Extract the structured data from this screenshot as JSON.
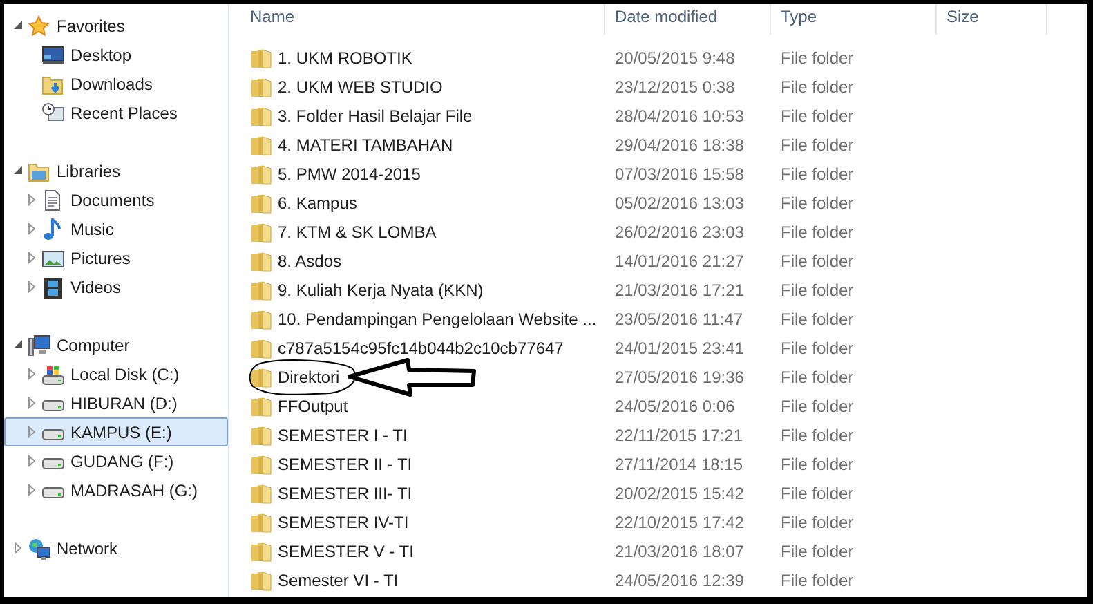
{
  "sidebar": {
    "groups": [
      {
        "label": "Favorites",
        "kind": "favorites",
        "expanded": true,
        "children": [
          {
            "label": "Desktop",
            "kind": "desktop"
          },
          {
            "label": "Downloads",
            "kind": "downloads"
          },
          {
            "label": "Recent Places",
            "kind": "recent"
          }
        ]
      },
      {
        "label": "Libraries",
        "kind": "libraries",
        "expanded": true,
        "children": [
          {
            "label": "Documents",
            "kind": "documents",
            "expanded": false,
            "selected": false
          },
          {
            "label": "Music",
            "kind": "music",
            "expanded": false,
            "selected": false
          },
          {
            "label": "Pictures",
            "kind": "pictures",
            "expanded": false,
            "selected": false
          },
          {
            "label": "Videos",
            "kind": "videos",
            "expanded": false,
            "selected": false
          }
        ]
      },
      {
        "label": "Computer",
        "kind": "computer",
        "expanded": true,
        "children": [
          {
            "label": "Local Disk (C:)",
            "kind": "system-drive",
            "expanded": false,
            "selected": false
          },
          {
            "label": "HIBURAN (D:)",
            "kind": "drive",
            "expanded": false,
            "selected": false
          },
          {
            "label": "KAMPUS (E:)",
            "kind": "drive",
            "expanded": false,
            "selected": true
          },
          {
            "label": "GUDANG (F:)",
            "kind": "drive",
            "expanded": false,
            "selected": false
          },
          {
            "label": "MADRASAH (G:)",
            "kind": "drive",
            "expanded": false,
            "selected": false
          }
        ]
      },
      {
        "label": "Network",
        "kind": "network",
        "expanded": false
      }
    ]
  },
  "table": {
    "columns": [
      "Name",
      "Date modified",
      "Type",
      "Size"
    ],
    "rows": [
      {
        "name": "1. UKM ROBOTIK",
        "date": "20/05/2015 9:48",
        "type": "File folder"
      },
      {
        "name": "2. UKM WEB STUDIO",
        "date": "23/12/2015 0:38",
        "type": "File folder"
      },
      {
        "name": "3. Folder Hasil Belajar File",
        "date": "28/04/2016 10:53",
        "type": "File folder"
      },
      {
        "name": "4. MATERI TAMBAHAN",
        "date": "29/04/2016 18:38",
        "type": "File folder"
      },
      {
        "name": "5. PMW 2014-2015",
        "date": "07/03/2016 15:58",
        "type": "File folder"
      },
      {
        "name": "6. Kampus",
        "date": "05/02/2016 13:03",
        "type": "File folder"
      },
      {
        "name": "7. KTM & SK LOMBA",
        "date": "26/02/2016 23:03",
        "type": "File folder"
      },
      {
        "name": "8. Asdos",
        "date": "14/01/2016 21:27",
        "type": "File folder"
      },
      {
        "name": "9. Kuliah Kerja Nyata (KKN)",
        "date": "21/03/2016 17:21",
        "type": "File folder"
      },
      {
        "name": "10. Pendampingan Pengelolaan Website ...",
        "date": "23/05/2016 11:47",
        "type": "File folder"
      },
      {
        "name": "c787a5154c95fc14b044b2c10cb77647",
        "date": "24/01/2015 23:41",
        "type": "File folder"
      },
      {
        "name": "Direktori",
        "date": "27/05/2016 19:36",
        "type": "File folder",
        "annotated": true
      },
      {
        "name": "FFOutput",
        "date": "24/05/2016 0:06",
        "type": "File folder"
      },
      {
        "name": "SEMESTER I - TI",
        "date": "22/11/2015 17:21",
        "type": "File folder"
      },
      {
        "name": "SEMESTER II - TI",
        "date": "27/11/2014 18:15",
        "type": "File folder"
      },
      {
        "name": "SEMESTER III- TI",
        "date": "20/02/2015 15:42",
        "type": "File folder"
      },
      {
        "name": "SEMESTER IV-TI",
        "date": "22/10/2015 17:42",
        "type": "File folder"
      },
      {
        "name": "SEMESTER V - TI",
        "date": "21/03/2016 18:07",
        "type": "File folder"
      },
      {
        "name": "Semester VI - TI",
        "date": "24/05/2016 12:39",
        "type": "File folder"
      }
    ]
  }
}
